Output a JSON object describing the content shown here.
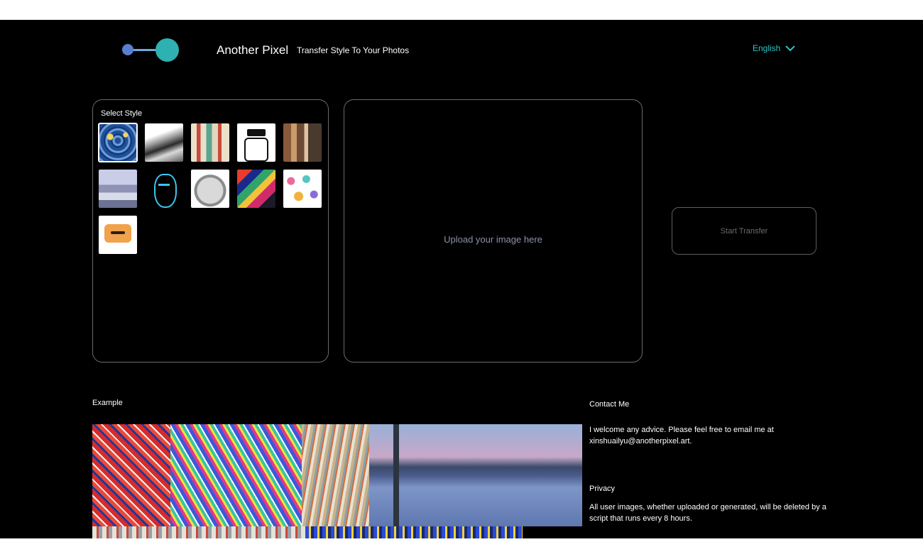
{
  "header": {
    "brand": "Another Pixel",
    "tagline": "Transfer Style To Your Photos",
    "language": "English",
    "accent_color": "#2fc3c3"
  },
  "style_panel": {
    "title": "Select Style",
    "styles": [
      {
        "name": "starry-night",
        "selected": true
      },
      {
        "name": "ink-landscape"
      },
      {
        "name": "cubist-figure"
      },
      {
        "name": "line-sketch"
      },
      {
        "name": "impressionist-portrait"
      },
      {
        "name": "pastel-figures"
      },
      {
        "name": "neon-mask"
      },
      {
        "name": "marble-statue"
      },
      {
        "name": "abstract-color"
      },
      {
        "name": "feather-pattern"
      },
      {
        "name": "pixel-cat"
      }
    ]
  },
  "upload": {
    "hint": "Upload your image here"
  },
  "actions": {
    "start_label": "Start Transfer"
  },
  "example": {
    "title": "Example"
  },
  "contact": {
    "title": "Contact Me",
    "text": "I welcome any advice. Please feel free to email me at xinshuailyu@anotherpixel.art."
  },
  "privacy": {
    "title": "Privacy",
    "text": "All user images, whether uploaded or generated, will be deleted by a script that runs every 8 hours."
  }
}
